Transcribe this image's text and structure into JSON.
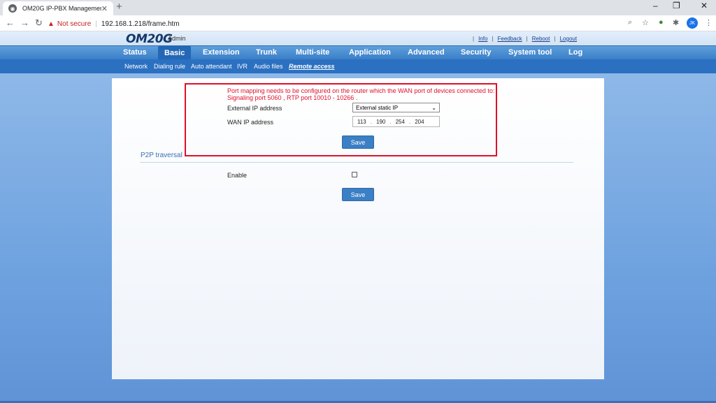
{
  "browser": {
    "tab_title": "OM20G IP-PBX Management",
    "tab_close": "✕",
    "new_tab": "+",
    "window_controls": {
      "minimize": "–",
      "restore": "❐",
      "close": "✕"
    },
    "security_label": "Not secure",
    "url": "192.168.1.218/frame.htm",
    "profile_initials": "JK"
  },
  "header": {
    "logo": "OM20G",
    "role": "Admin",
    "links": [
      "Info",
      "Feedback",
      "Reboot",
      "Logout"
    ]
  },
  "main_nav": [
    "Status",
    "Basic",
    "Extension",
    "Trunk",
    "Multi-site",
    "Application",
    "Advanced",
    "Security",
    "System tool",
    "Log"
  ],
  "main_nav_active": "Basic",
  "sub_nav": [
    "Network",
    "Dialing rule",
    "Auto attendant",
    "IVR",
    "Audio files",
    "Remote access"
  ],
  "sub_nav_active": "Remote access",
  "remote_access": {
    "notice_line1": "Port mapping needs to be configured on the router which the WAN port of devices connected to:",
    "notice_line2": "Signaling port   5060  , RTP port   10010  -  10266  .",
    "external_ip_label": "External IP address",
    "external_ip_value": "External static IP",
    "wan_ip_label": "WAN IP address",
    "wan_ip": [
      "113",
      "190",
      "254",
      "204"
    ],
    "save_label": "Save"
  },
  "p2p": {
    "section_title": "P2P traversal",
    "enable_label": "Enable",
    "enabled": false,
    "save_label": "Save"
  },
  "colors": {
    "accent": "#3b7fc5",
    "highlight_box": "#e0102a",
    "notice_text": "#e0102a"
  }
}
